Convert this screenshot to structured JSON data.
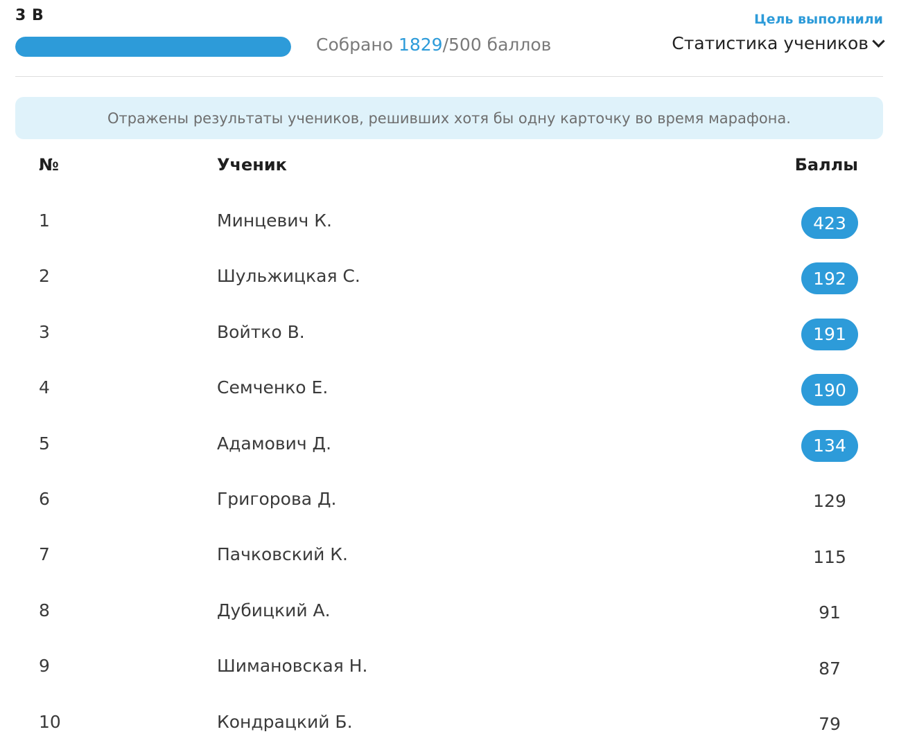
{
  "header": {
    "class_name": "3 В",
    "collected_prefix": "Собрано ",
    "collected_current": "1829",
    "collected_suffix": "/500 баллов",
    "progress_fraction": 1.0,
    "goal_link": "Цель выполнили",
    "stats_dropdown": "Статистика учеников"
  },
  "notice": "Отражены результаты учеников, решивших хотя бы одну карточку во время марафона.",
  "table": {
    "columns": [
      "№",
      "Ученик",
      "Баллы"
    ],
    "rows": [
      {
        "num": "1",
        "name": "Минцевич К.",
        "score": "423",
        "highlight": true
      },
      {
        "num": "2",
        "name": "Шульжицкая С.",
        "score": "192",
        "highlight": true
      },
      {
        "num": "3",
        "name": "Войтко В.",
        "score": "191",
        "highlight": true
      },
      {
        "num": "4",
        "name": "Семченко Е.",
        "score": "190",
        "highlight": true
      },
      {
        "num": "5",
        "name": "Адамович Д.",
        "score": "134",
        "highlight": true
      },
      {
        "num": "6",
        "name": "Григорова Д.",
        "score": "129",
        "highlight": false
      },
      {
        "num": "7",
        "name": "Пачковский К.",
        "score": "115",
        "highlight": false
      },
      {
        "num": "8",
        "name": "Дубицкий А.",
        "score": "91",
        "highlight": false
      },
      {
        "num": "9",
        "name": "Шимановская Н.",
        "score": "87",
        "highlight": false
      },
      {
        "num": "10",
        "name": "Кондрацкий Б.",
        "score": "79",
        "highlight": false
      }
    ]
  },
  "colors": {
    "accent": "#2d9bd9",
    "notice_bg": "#dff2fa"
  },
  "icons": {
    "dropdown": "chevron-down-icon"
  }
}
